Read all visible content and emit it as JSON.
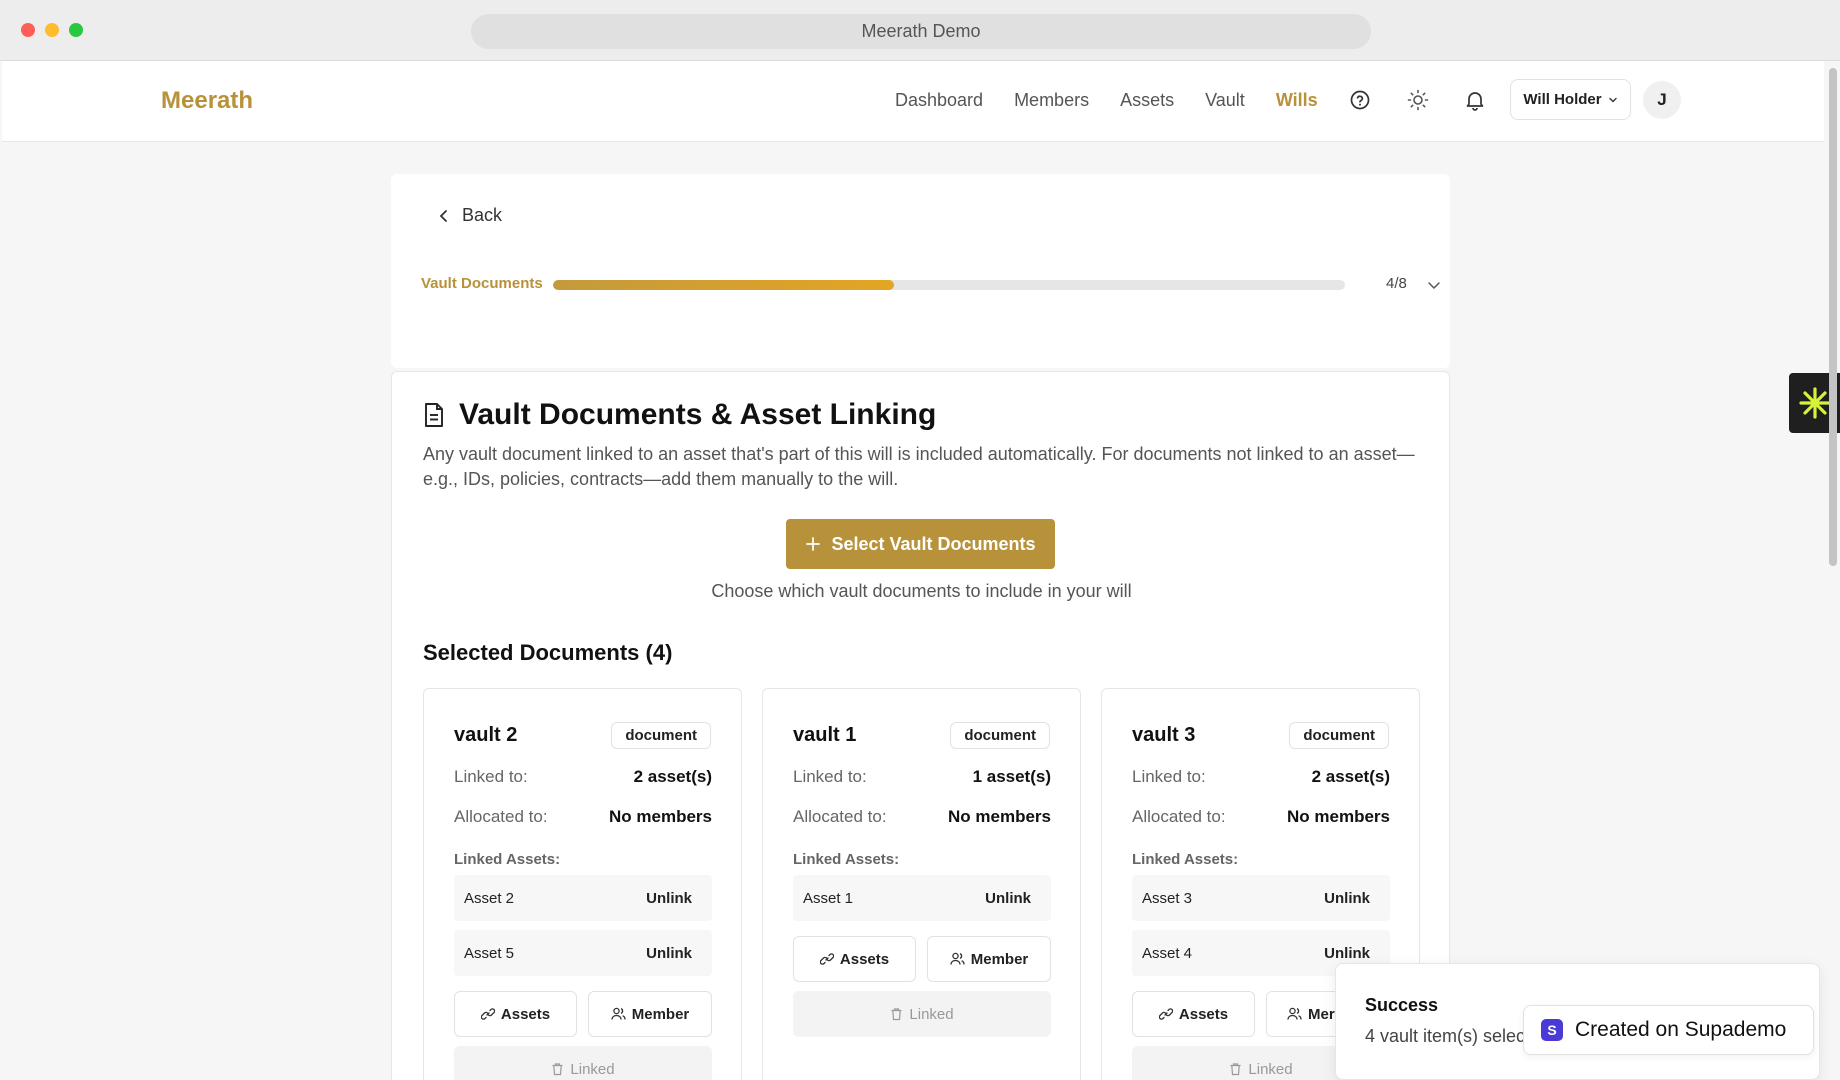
{
  "window": {
    "title": "Meerath Demo"
  },
  "nav": {
    "logo": "Meerath",
    "links": [
      "Dashboard",
      "Members",
      "Assets",
      "Vault",
      "Wills"
    ],
    "active": "Wills",
    "user_label": "Will Holder",
    "avatar_initial": "J"
  },
  "top": {
    "back_label": "Back",
    "progress_label": "Vault Documents",
    "progress_count": "4/8",
    "progress_fraction": 0.43
  },
  "main": {
    "title": "Vault Documents & Asset Linking",
    "description": "Any vault document linked to an asset that's part of this will is included automatically. For documents not linked to an asset—e.g., IDs, policies, contracts—add them manually to the will.",
    "select_button": "Select Vault Documents",
    "choose_text": "Choose which vault documents to include in your will",
    "selected_title": "Selected Documents (4)"
  },
  "labels": {
    "linked_to": "Linked to:",
    "allocated_to": "Allocated to:",
    "linked_assets": "Linked Assets:",
    "unlink": "Unlink",
    "assets_btn": "Assets",
    "member_btn": "Member",
    "member_btn_truncated": "Mer",
    "linked_btn": "Linked"
  },
  "documents": [
    {
      "name": "vault 2",
      "type": "document",
      "linked_to": "2 asset(s)",
      "allocated_to": "No members",
      "assets": [
        "Asset 2",
        "Asset 5"
      ]
    },
    {
      "name": "vault 1",
      "type": "document",
      "linked_to": "1 asset(s)",
      "allocated_to": "No members",
      "assets": [
        "Asset 1"
      ]
    },
    {
      "name": "vault 3",
      "type": "document",
      "linked_to": "2 asset(s)",
      "allocated_to": "No members",
      "assets": [
        "Asset 3",
        "Asset 4"
      ]
    }
  ],
  "toast": {
    "title": "Success",
    "message": "4 vault item(s) selected"
  },
  "supademo": {
    "label": "Created on Supademo",
    "logo_letter": "S"
  },
  "colors": {
    "accent": "#b8923a",
    "progress": "#e3a524",
    "supademo": "#4b3bd6"
  }
}
